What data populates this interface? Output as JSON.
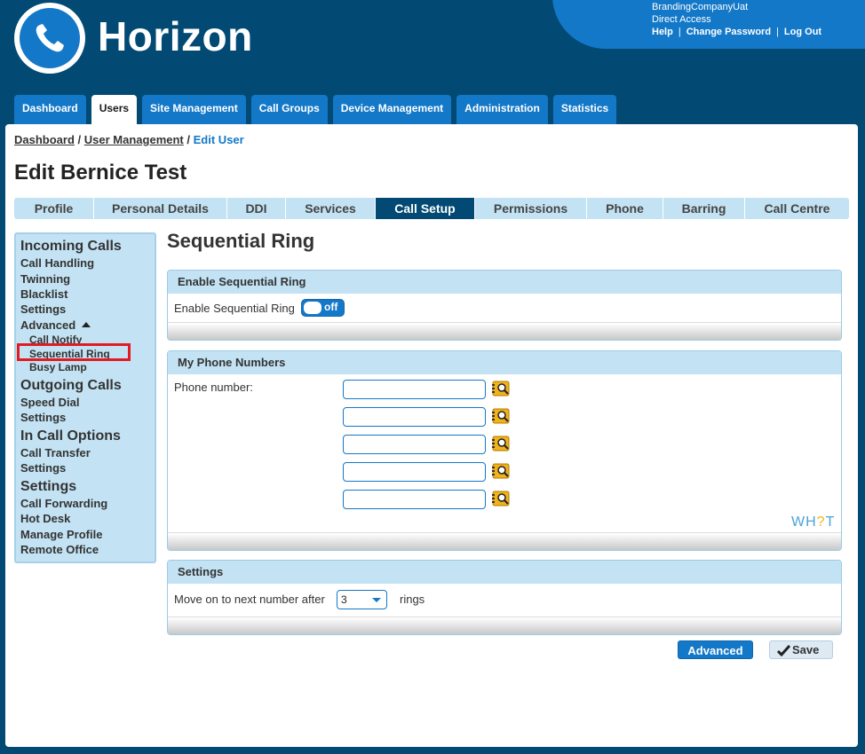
{
  "header": {
    "brand": "Horizon",
    "account": {
      "company": "BrandingCompanyUat",
      "role": "Direct Access",
      "links": [
        "Help",
        "Change Password",
        "Log Out"
      ]
    },
    "link_separator": "|"
  },
  "main_tabs": [
    {
      "label": "Dashboard",
      "active": false
    },
    {
      "label": "Users",
      "active": true
    },
    {
      "label": "Site Management",
      "active": false
    },
    {
      "label": "Call Groups",
      "active": false
    },
    {
      "label": "Device Management",
      "active": false
    },
    {
      "label": "Administration",
      "active": false
    },
    {
      "label": "Statistics",
      "active": false
    }
  ],
  "breadcrumb": {
    "items": [
      "Dashboard",
      "User Management"
    ],
    "current": "Edit User",
    "separator": "/"
  },
  "page_title": "Edit Bernice Test",
  "sub_tabs": [
    {
      "label": "Profile",
      "active": false
    },
    {
      "label": "Personal Details",
      "active": false
    },
    {
      "label": "DDI",
      "active": false
    },
    {
      "label": "Services",
      "active": false
    },
    {
      "label": "Call Setup",
      "active": true
    },
    {
      "label": "Permissions",
      "active": false
    },
    {
      "label": "Phone",
      "active": false
    },
    {
      "label": "Barring",
      "active": false
    },
    {
      "label": "Call Centre",
      "active": false
    }
  ],
  "left_nav": {
    "incoming_heading": "Incoming Calls",
    "call_handling": "Call Handling",
    "twinning": "Twinning",
    "blacklist": "Blacklist",
    "settings": "Settings",
    "advanced": "Advanced",
    "call_notify": "Call Notify",
    "sequential_ring": "Sequential Ring",
    "busy_lamp": "Busy Lamp",
    "outgoing_heading": "Outgoing Calls",
    "speed_dial": "Speed Dial",
    "outgoing_settings": "Settings",
    "in_call_heading": "In Call Options",
    "call_transfer": "Call Transfer",
    "in_call_settings": "Settings",
    "settings_heading": "Settings",
    "call_forwarding": "Call Forwarding",
    "hot_desk": "Hot Desk",
    "manage_profile": "Manage Profile",
    "remote_office": "Remote Office"
  },
  "section_title": "Sequential Ring",
  "enable_panel": {
    "header": "Enable Sequential Ring",
    "label": "Enable Sequential Ring",
    "toggle_state": "off"
  },
  "numbers_panel": {
    "header": "My Phone Numbers",
    "label": "Phone number:",
    "phone_numbers": [
      "",
      "",
      "",
      "",
      ""
    ],
    "logo": "WH?T"
  },
  "settings_panel": {
    "header": "Settings",
    "label_before": "Move on to next number after",
    "rings_value": "3",
    "label_after": "rings"
  },
  "buttons": {
    "advanced": "Advanced",
    "save": "Save"
  },
  "colors": {
    "background": "#024a73",
    "accent": "#1478c8",
    "panel_header": "#c3e2f3",
    "highlight": "#e21a22"
  }
}
